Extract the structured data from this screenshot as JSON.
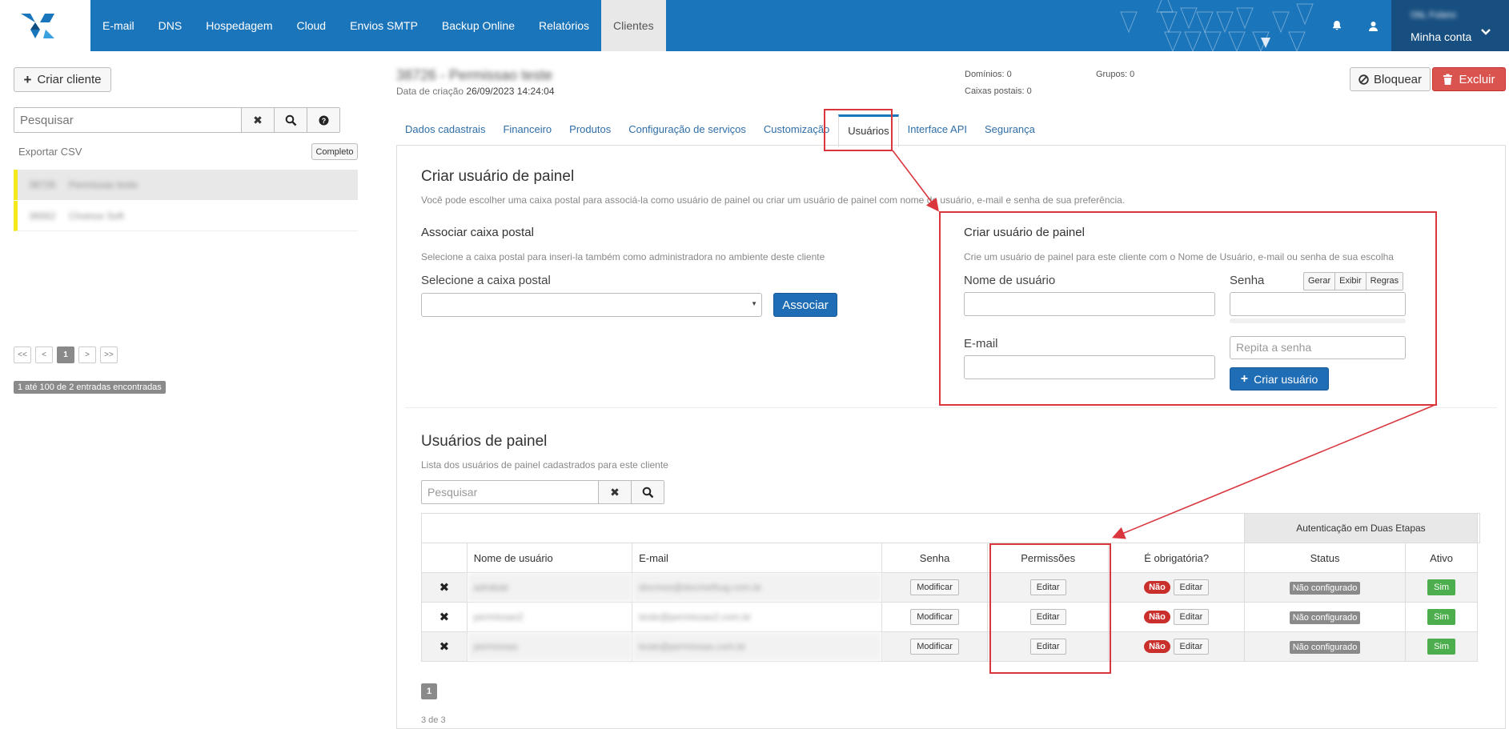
{
  "nav": {
    "items": [
      "E-mail",
      "DNS",
      "Hospedagem",
      "Cloud",
      "Envios SMTP",
      "Backup Online",
      "Relatórios",
      "Clientes"
    ],
    "active_item": "Clientes",
    "account_name": "Olá, Fulano",
    "account_label": "Minha conta"
  },
  "left": {
    "create_client_label": "Criar cliente",
    "search_placeholder": "Pesquisar",
    "export_csv_label": "Exportar CSV",
    "completo_label": "Completo",
    "clients": [
      {
        "id": "38726",
        "name": "Permissao teste"
      },
      {
        "id": "36562",
        "name": "Choinox Soft"
      }
    ],
    "pagination": [
      "<<",
      "<",
      "1",
      ">",
      ">>"
    ],
    "current_page": "1",
    "entries_text": "1 até 100 de 2 entradas encontradas"
  },
  "client": {
    "title": "38726 - Permissao teste",
    "created_label": "Data de criação",
    "created_value": "26/09/2023 14:24:04",
    "dominios": "Domínios: 0",
    "caixas": "Caixas postais: 0",
    "grupos": "Grupos: 0",
    "bloquear_label": "Bloquear",
    "excluir_label": "Excluir"
  },
  "tabs": [
    "Dados cadastrais",
    "Financeiro",
    "Produtos",
    "Configuração de serviços",
    "Customização",
    "Usuários",
    "Interface API",
    "Segurança"
  ],
  "active_tab": "Usuários",
  "create_panel_user": {
    "title": "Criar usuário de painel",
    "description": "Você pode escolher uma caixa postal para associá-la como usuário de painel ou criar um usuário de painel com nome de usuário, e-mail e senha de sua preferência.",
    "associate": {
      "title": "Associar caixa postal",
      "description": "Selecione a caixa postal para inseri-la também como administradora no ambiente deste cliente",
      "select_label": "Selecione a caixa postal",
      "select_value": "",
      "button_label": "Associar"
    },
    "create": {
      "title": "Criar usuário de painel",
      "description": "Crie um usuário de painel para este cliente com o Nome de Usuário, e-mail ou senha de sua escolha",
      "username_label": "Nome de usuário",
      "password_label": "Senha",
      "password_tools": [
        "Gerar",
        "Exibir",
        "Regras"
      ],
      "email_label": "E-mail",
      "repeat_placeholder": "Repita a senha",
      "button_label": "Criar usuário"
    }
  },
  "panel_users": {
    "title": "Usuários de painel",
    "description": "Lista dos usuários de painel cadastrados para este cliente",
    "search_placeholder": "Pesquisar",
    "group_header": "Autenticação em Duas Etapas",
    "columns": [
      "Nome de usuário",
      "E-mail",
      "Senha",
      "Permissões",
      "É obrigatória?",
      "Status",
      "Ativo"
    ],
    "rows": [
      {
        "username": "adrabair",
        "email": "docmee@docmelhug.com.br",
        "senha_btn": "Modificar",
        "perm_btn": "Editar",
        "obrig": "Não",
        "obrig_btn": "Editar",
        "status": "Não configurado",
        "ativo": "Sim"
      },
      {
        "username": "permissao2",
        "email": "teste@permissao2.com.br",
        "senha_btn": "Modificar",
        "perm_btn": "Editar",
        "obrig": "Não",
        "obrig_btn": "Editar",
        "status": "Não configurado",
        "ativo": "Sim"
      },
      {
        "username": "permissao",
        "email": "teste@permissao.com.br",
        "senha_btn": "Modificar",
        "perm_btn": "Editar",
        "obrig": "Não",
        "obrig_btn": "Editar",
        "status": "Não configurado",
        "ativo": "Sim"
      }
    ],
    "page": "1",
    "footer_text": "3 de 3"
  },
  "colors": {
    "nav_bg": "#1b75bb",
    "primary": "#1f6db5",
    "danger": "#d9534f",
    "success": "#4cae4c",
    "highlight": "#f5e81b",
    "annotation": "#d9363e"
  }
}
